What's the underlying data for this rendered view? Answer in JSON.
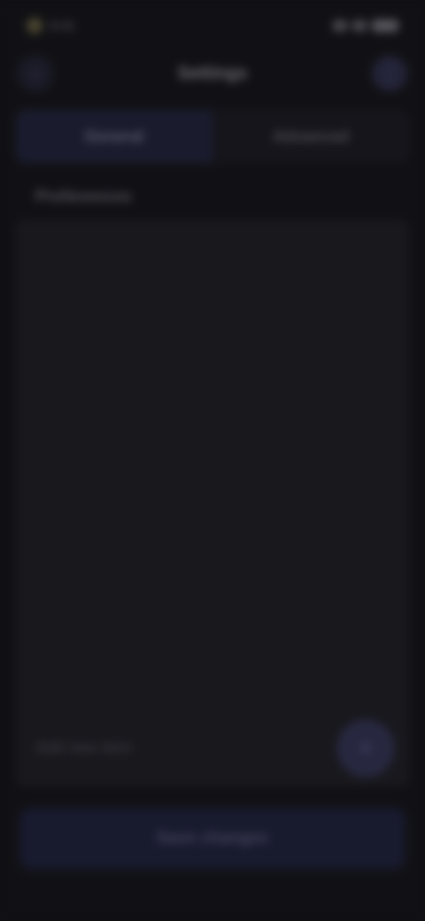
{
  "status_bar": {
    "time": "9:41"
  },
  "header": {
    "title": "Settings",
    "back_glyph": "‹",
    "menu_glyph": "⋮"
  },
  "tabs": [
    {
      "label": "General",
      "active": true
    },
    {
      "label": "Advanced",
      "active": false
    }
  ],
  "section": {
    "heading": "Preferences"
  },
  "footer": {
    "label": "Add new item",
    "fab_glyph": "+"
  },
  "primary_action": {
    "label": "Save changes"
  },
  "colors": {
    "background": "#111115",
    "accent": "#27273f"
  },
  "icons": [
    "signal-icon",
    "wifi-icon",
    "battery-icon",
    "back-arrow-icon",
    "more-options-icon",
    "plus-icon"
  ]
}
